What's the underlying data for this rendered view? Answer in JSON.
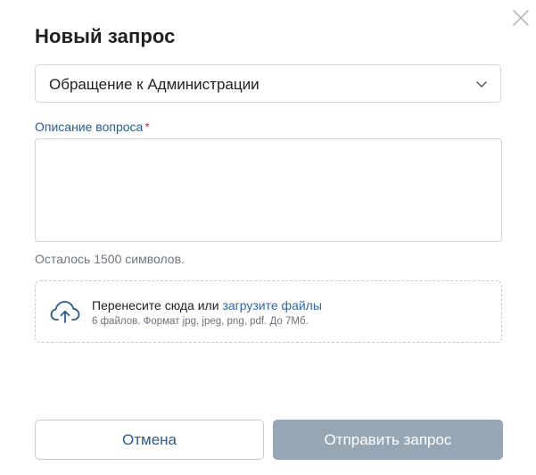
{
  "dialog": {
    "title": "Новый запрос",
    "close_icon": "close-icon"
  },
  "request_type": {
    "selected": "Обращение к Администрации",
    "icon": "chevron-down-icon"
  },
  "description": {
    "label": "Описание вопроса",
    "required_mark": "*",
    "value": "",
    "placeholder": "",
    "counter_text": "Осталось 1500 символов."
  },
  "upload": {
    "icon": "cloud-upload-icon",
    "text_prefix": "Перенесите сюда или ",
    "link_text": "загрузите файлы",
    "hint": "6 файлов. Формат jpg, jpeg, png, pdf. До 7Мб."
  },
  "actions": {
    "cancel_label": "Отмена",
    "submit_label": "Отправить запрос"
  },
  "colors": {
    "accent": "#2b5b8c",
    "link": "#2f67a3",
    "required": "#d9323a",
    "submit_disabled": "#97a6b5"
  }
}
